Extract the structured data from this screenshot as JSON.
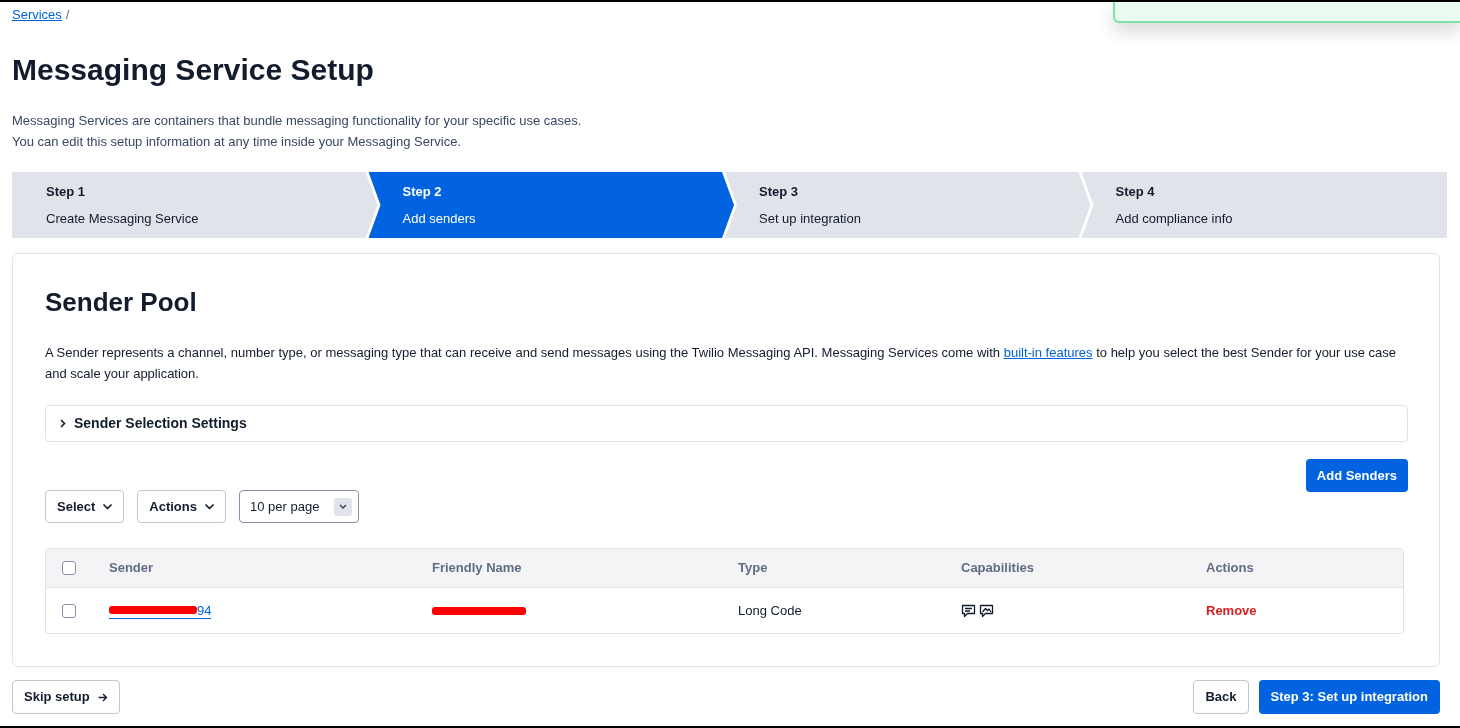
{
  "notification": {
    "kind": "success"
  },
  "breadcrumb": [
    {
      "label": "Services",
      "separator": "/"
    }
  ],
  "title": "Messaging Service Setup",
  "description": [
    "Messaging Services are containers that bundle messaging functionality for your specific use cases.",
    "You can edit this setup information at any time inside your Messaging Service."
  ],
  "steps": [
    {
      "label": "Step 1",
      "text": "Create Messaging Service",
      "selected": false
    },
    {
      "label": "Step 2",
      "text": "Add senders",
      "selected": true
    },
    {
      "label": "Step 3",
      "text": "Set up integration",
      "selected": false
    },
    {
      "label": "Step 4",
      "text": "Add compliance info",
      "selected": false
    }
  ],
  "sender_pool": {
    "title": "Sender Pool",
    "intro": {
      "before": "A Sender represents a channel, number type, or messaging type that can receive and send messages using the Twilio Messaging API. Messaging Services come with ",
      "link": "built-in features",
      "after": " to help you select the best Sender for your use case and scale your application."
    },
    "accordion": {
      "label": "Sender Selection Settings",
      "expanded": false
    },
    "add_button": "Add Senders",
    "filters": [
      {
        "label": "Select"
      },
      {
        "label": "Actions"
      }
    ],
    "page_size": {
      "value": "10 per page"
    },
    "table": {
      "header_checkbox": {
        "checked": false
      },
      "columns": [
        "Sender",
        "Friendly Name",
        "Type",
        "Capabilities",
        "Actions"
      ],
      "rows": [
        {
          "checked": false,
          "sender": {
            "text": "94",
            "redacted": true
          },
          "friendly_name": {
            "redacted": true
          },
          "type": "Long Code",
          "action": "Remove"
        }
      ]
    }
  },
  "footer": {
    "skip": "Skip setup",
    "back": "Back",
    "next": "Step 3: Set up integration"
  }
}
